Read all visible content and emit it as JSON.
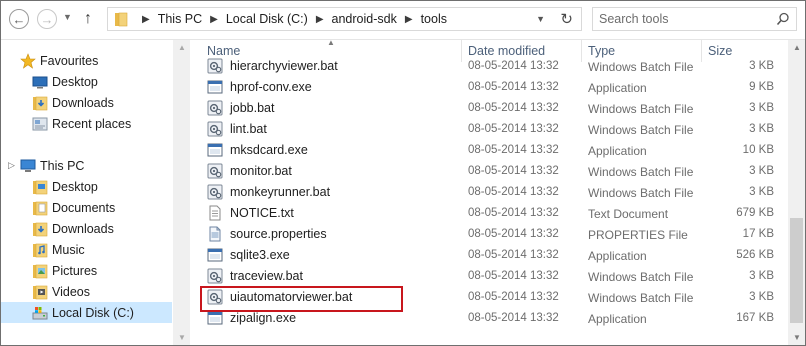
{
  "toolbar": {
    "breadcrumbs": [
      "This PC",
      "Local Disk (C:)",
      "android-sdk",
      "tools"
    ],
    "search_placeholder": "Search tools"
  },
  "nav": {
    "favourites": {
      "label": "Favourites",
      "items": [
        {
          "label": "Desktop",
          "icon": "desktop-icon"
        },
        {
          "label": "Downloads",
          "icon": "downloads-icon"
        },
        {
          "label": "Recent places",
          "icon": "recent-places-icon"
        }
      ]
    },
    "this_pc": {
      "label": "This PC",
      "items": [
        {
          "label": "Desktop",
          "icon": "desktop-folder-icon"
        },
        {
          "label": "Documents",
          "icon": "documents-icon"
        },
        {
          "label": "Downloads",
          "icon": "downloads-icon"
        },
        {
          "label": "Music",
          "icon": "music-icon"
        },
        {
          "label": "Pictures",
          "icon": "pictures-icon"
        },
        {
          "label": "Videos",
          "icon": "videos-icon"
        },
        {
          "label": "Local Disk (C:)",
          "icon": "local-disk-icon",
          "selected": true
        }
      ]
    }
  },
  "columns": {
    "name": "Name",
    "date": "Date modified",
    "type": "Type",
    "size": "Size"
  },
  "files": [
    {
      "name": "hierarchyviewer.bat",
      "date": "08-05-2014 13:32",
      "type": "Windows Batch File",
      "size": "3 KB",
      "icon": "batch-file-icon"
    },
    {
      "name": "hprof-conv.exe",
      "date": "08-05-2014 13:32",
      "type": "Application",
      "size": "9 KB",
      "icon": "application-icon"
    },
    {
      "name": "jobb.bat",
      "date": "08-05-2014 13:32",
      "type": "Windows Batch File",
      "size": "3 KB",
      "icon": "batch-file-icon"
    },
    {
      "name": "lint.bat",
      "date": "08-05-2014 13:32",
      "type": "Windows Batch File",
      "size": "3 KB",
      "icon": "batch-file-icon"
    },
    {
      "name": "mksdcard.exe",
      "date": "08-05-2014 13:32",
      "type": "Application",
      "size": "10 KB",
      "icon": "application-icon"
    },
    {
      "name": "monitor.bat",
      "date": "08-05-2014 13:32",
      "type": "Windows Batch File",
      "size": "3 KB",
      "icon": "batch-file-icon"
    },
    {
      "name": "monkeyrunner.bat",
      "date": "08-05-2014 13:32",
      "type": "Windows Batch File",
      "size": "3 KB",
      "icon": "batch-file-icon"
    },
    {
      "name": "NOTICE.txt",
      "date": "08-05-2014 13:32",
      "type": "Text Document",
      "size": "679 KB",
      "icon": "text-document-icon"
    },
    {
      "name": "source.properties",
      "date": "08-05-2014 13:32",
      "type": "PROPERTIES File",
      "size": "17 KB",
      "icon": "properties-file-icon"
    },
    {
      "name": "sqlite3.exe",
      "date": "08-05-2014 13:32",
      "type": "Application",
      "size": "526 KB",
      "icon": "application-icon"
    },
    {
      "name": "traceview.bat",
      "date": "08-05-2014 13:32",
      "type": "Windows Batch File",
      "size": "3 KB",
      "icon": "batch-file-icon"
    },
    {
      "name": "uiautomatorviewer.bat",
      "date": "08-05-2014 13:32",
      "type": "Windows Batch File",
      "size": "3 KB",
      "icon": "batch-file-icon",
      "highlighted": true
    },
    {
      "name": "zipalign.exe",
      "date": "08-05-2014 13:32",
      "type": "Application",
      "size": "167 KB",
      "icon": "application-icon"
    }
  ],
  "colors": {
    "highlight_box": "#c8161d",
    "selected_nav": "#cce8ff",
    "header_text": "#4c607a"
  }
}
